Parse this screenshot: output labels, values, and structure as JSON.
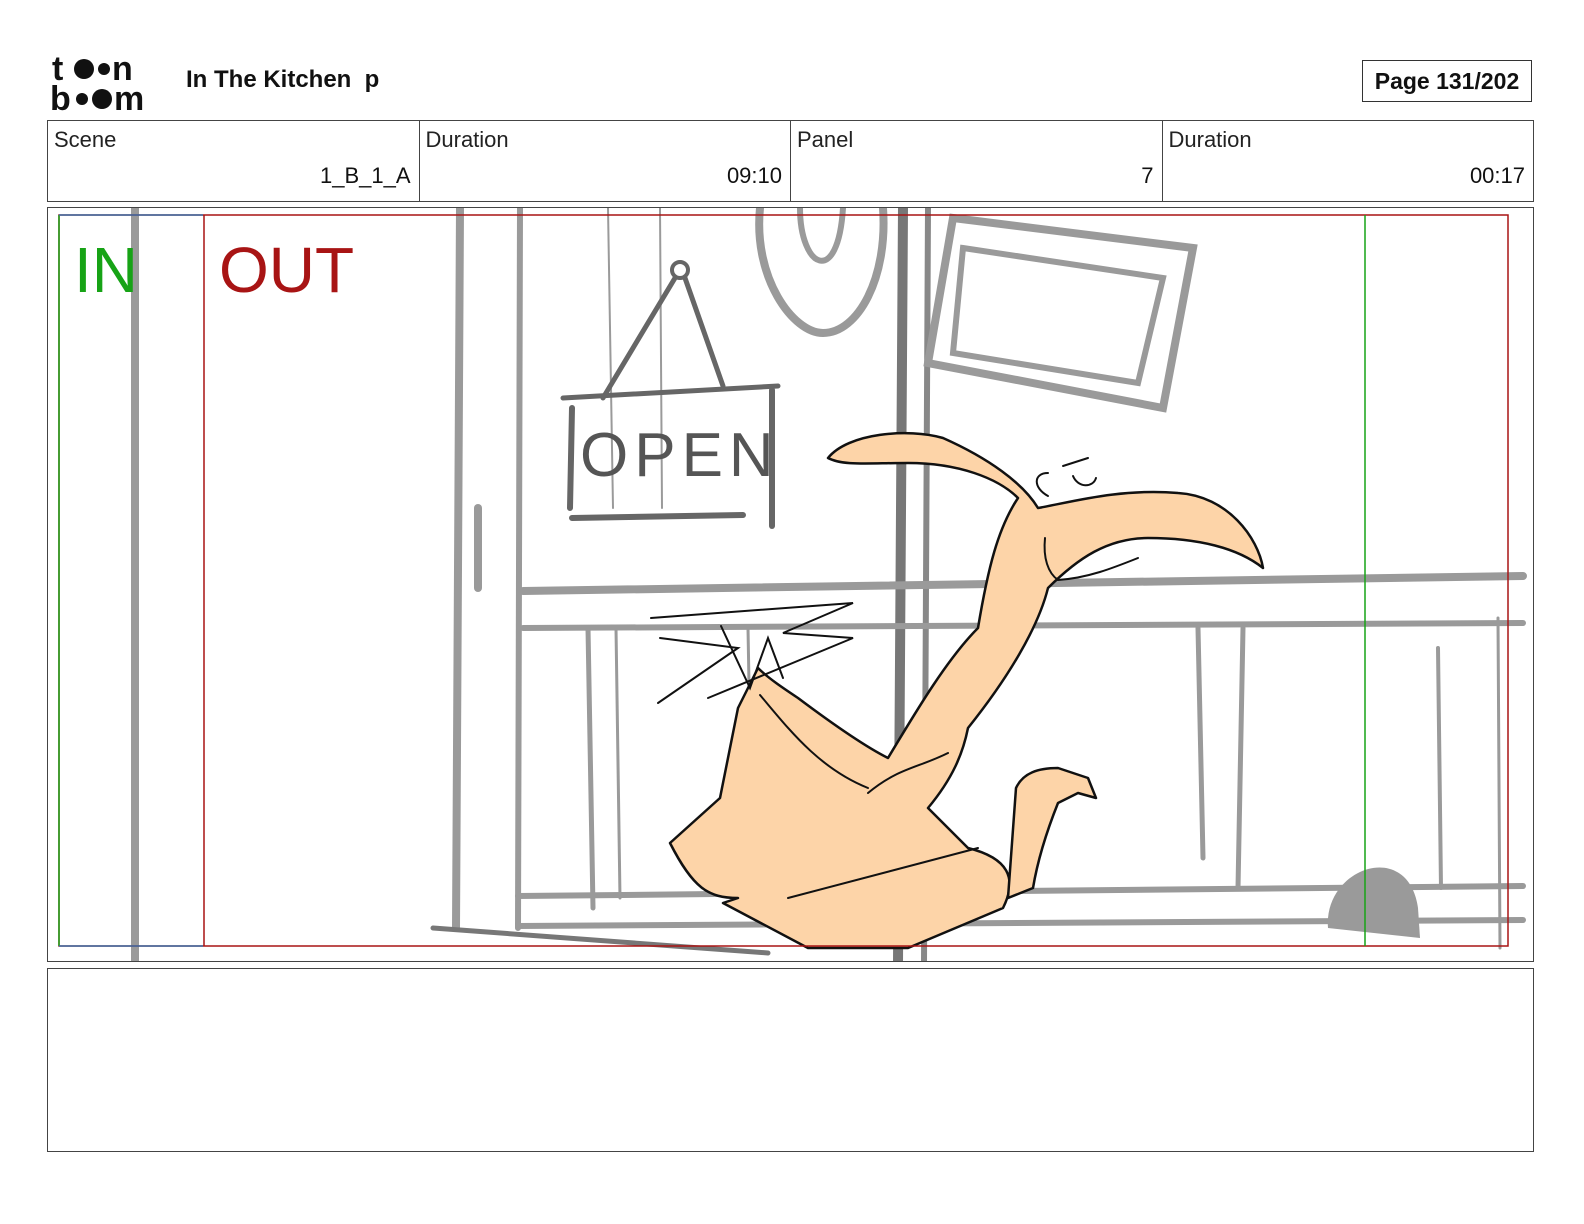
{
  "header": {
    "logo_text": "toon boom",
    "title": "In The Kitchen  p",
    "page_label": "Page 131/202"
  },
  "info": {
    "scene_label": "Scene",
    "scene_value": "1_B_1_A",
    "scene_duration_label": "Duration",
    "scene_duration_value": "09:10",
    "panel_label": "Panel",
    "panel_value": "7",
    "panel_duration_label": "Duration",
    "panel_duration_value": "00:17"
  },
  "panel": {
    "in_label": "IN",
    "out_label": "OUT",
    "sign_text": "OPEN",
    "colors": {
      "in": "#17a316",
      "out": "#a81414",
      "character_fill": "#fdd4a8",
      "sketch": "#9a9a9a"
    }
  },
  "notes": {
    "text": ""
  }
}
